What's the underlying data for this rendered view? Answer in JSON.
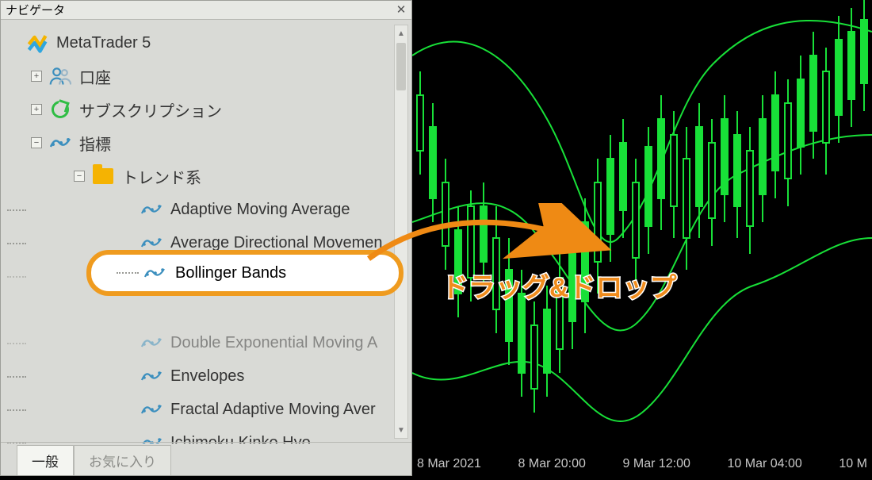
{
  "nav": {
    "title": "ナビゲータ",
    "root": "MetaTrader 5",
    "accounts": "口座",
    "subscription": "サブスクリプション",
    "indicators": "指標",
    "trend_folder": "トレンド系",
    "items": {
      "ama": "Adaptive Moving Average",
      "adm1": "Average Directional Movemen",
      "adm2": "Average Directional Movemen",
      "bb": "Bollinger Bands",
      "dema": "Double Exponential Moving A",
      "env": "Envelopes",
      "fama": "Fractal Adaptive Moving Aver",
      "ikh": "Ichimoku Kinko Hyo"
    }
  },
  "tabs": {
    "general": "一般",
    "fav": "お気に入り"
  },
  "xaxis": [
    "8 Mar 2021",
    "8 Mar 20:00",
    "9 Mar 12:00",
    "10 Mar 04:00",
    "10 M"
  ],
  "overlay_label": "ドラッグ&ドロップ"
}
